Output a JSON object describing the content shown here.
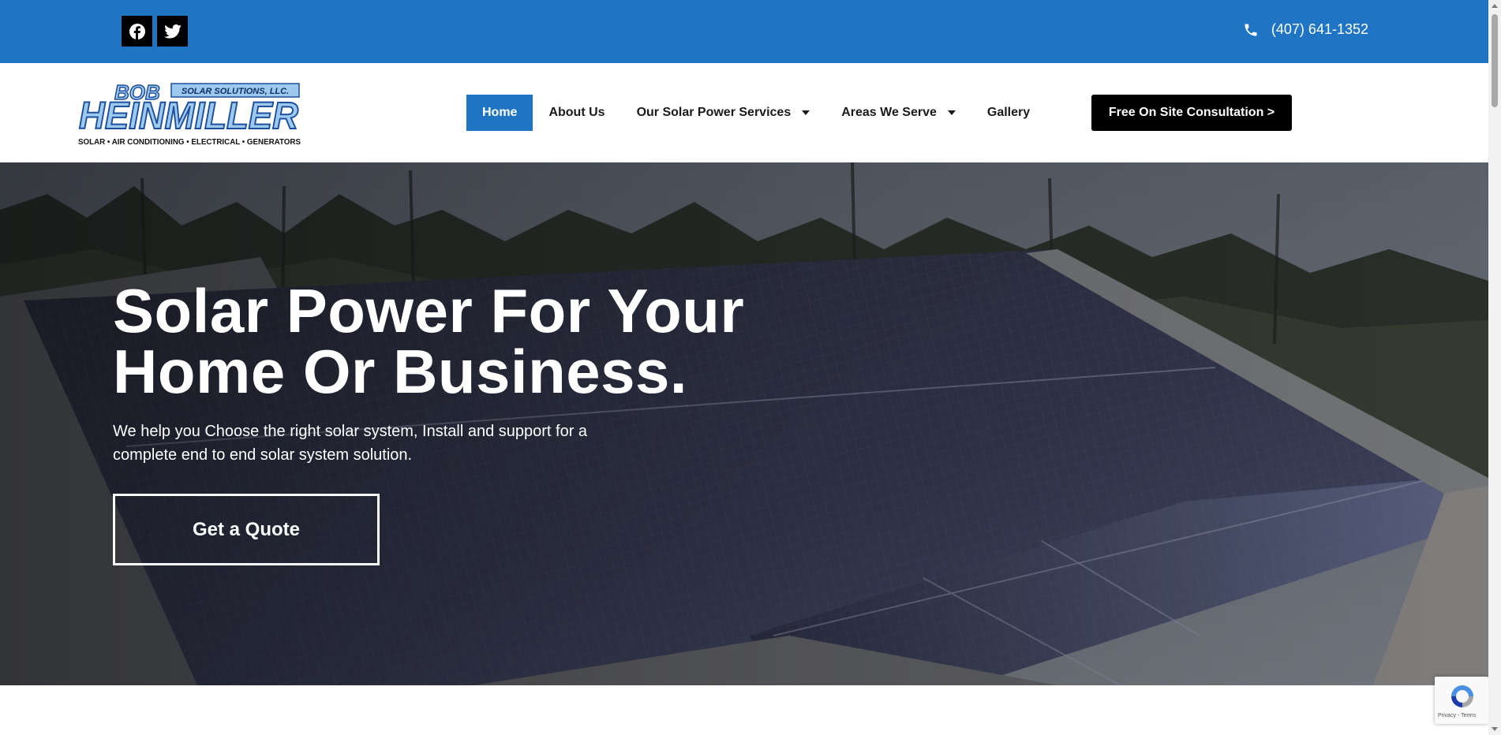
{
  "topbar": {
    "social": [
      "facebook-icon",
      "twitter-icon"
    ],
    "phone": "(407) 641-1352",
    "background": "#1f75c4"
  },
  "header": {
    "logo": {
      "word1": "BOB",
      "word2": "HEINMILLER",
      "tagline": "SOLAR SOLUTIONS, LLC.",
      "services_line": "SOLAR • AIR CONDITIONING • ELECTRICAL • GENERATORS"
    },
    "nav": [
      {
        "label": "Home",
        "active": true
      },
      {
        "label": "About Us",
        "active": false
      },
      {
        "label": "Our Solar Power Services",
        "dropdown": true
      },
      {
        "label": "Areas We Serve",
        "dropdown": true
      },
      {
        "label": "Gallery",
        "active": false
      }
    ],
    "cta": "Free On Site Consultation >"
  },
  "hero": {
    "title_line1": "Solar Power For Your",
    "title_line2": "Home Or Business.",
    "subtitle": "We help you Choose the right solar system, Install and support for a complete end to end solar system solution.",
    "button": "Get a Quote"
  },
  "recaptcha": {
    "privacy": "Privacy",
    "terms": "Terms"
  }
}
